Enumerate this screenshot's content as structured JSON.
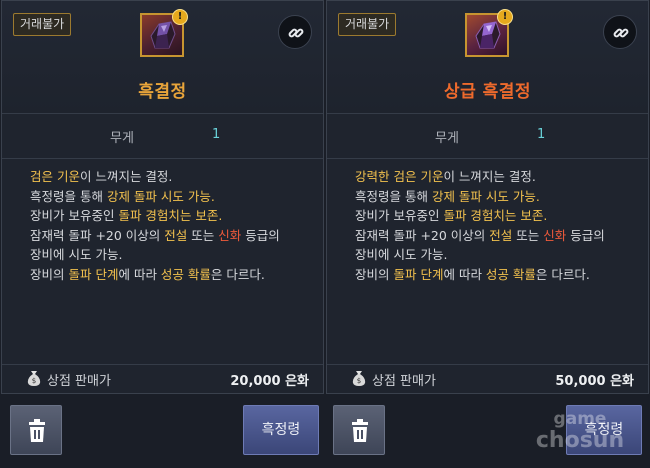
{
  "left_panel": {
    "trade_badge": "거래불가",
    "item_name": "흑결정",
    "stat_label": "무게",
    "stat_value": "1",
    "description": [
      [
        {
          "t": "검은 기운",
          "c": "y"
        },
        {
          "t": "이 느껴지는 결정.",
          "c": ""
        }
      ],
      [
        {
          "t": "흑정령을 통해 ",
          "c": ""
        },
        {
          "t": "강제 돌파 시도 가능.",
          "c": "y"
        }
      ],
      [
        {
          "t": "장비가 보유중인 ",
          "c": ""
        },
        {
          "t": "돌파 경험치는 보존.",
          "c": "y"
        }
      ],
      [
        {
          "t": "잠재력 돌파 +20 이상의 ",
          "c": ""
        },
        {
          "t": "전설",
          "c": "y"
        },
        {
          "t": " 또는 ",
          "c": ""
        },
        {
          "t": "신화",
          "c": "r"
        },
        {
          "t": " 등급의",
          "c": ""
        }
      ],
      [
        {
          "t": "장비에 시도 가능.",
          "c": ""
        }
      ],
      [
        {
          "t": "장비의 ",
          "c": ""
        },
        {
          "t": "돌파 단계",
          "c": "y"
        },
        {
          "t": "에 따라 ",
          "c": ""
        },
        {
          "t": "성공 확률",
          "c": "y"
        },
        {
          "t": "은 다르다.",
          "c": ""
        }
      ]
    ],
    "sale_label": "상점 판매가",
    "sale_value": "20,000 은화",
    "action_label": "흑정령"
  },
  "right_panel": {
    "trade_badge": "거래불가",
    "item_name": "상급 흑결정",
    "stat_label": "무게",
    "stat_value": "1",
    "description": [
      [
        {
          "t": "강력한 검은 기운",
          "c": "y"
        },
        {
          "t": "이 느껴지는 결정.",
          "c": ""
        }
      ],
      [
        {
          "t": "흑정령을 통해 ",
          "c": ""
        },
        {
          "t": "강제 돌파 시도 가능.",
          "c": "y"
        }
      ],
      [
        {
          "t": "장비가 보유중인 ",
          "c": ""
        },
        {
          "t": "돌파 경험치는 보존.",
          "c": "y"
        }
      ],
      [
        {
          "t": "잠재력 돌파 +20 이상의 ",
          "c": ""
        },
        {
          "t": "전설",
          "c": "y"
        },
        {
          "t": " 또는 ",
          "c": ""
        },
        {
          "t": "신화",
          "c": "r"
        },
        {
          "t": " 등급의",
          "c": ""
        }
      ],
      [
        {
          "t": "장비에 시도 가능.",
          "c": ""
        }
      ],
      [
        {
          "t": "장비의 ",
          "c": ""
        },
        {
          "t": "돌파 단계",
          "c": "y"
        },
        {
          "t": "에 따라 ",
          "c": ""
        },
        {
          "t": "성공 확률",
          "c": "y"
        },
        {
          "t": "은 다르다.",
          "c": ""
        }
      ]
    ],
    "sale_label": "상점 판매가",
    "sale_value": "50,000 은화",
    "action_label": "흑정령"
  },
  "icons": {
    "item": "dark-crystal-icon",
    "alert": "exclamation-badge-icon",
    "link": "link-icon",
    "money": "money-bag-icon",
    "trash": "trash-icon"
  },
  "colors": {
    "item_name_normal": "#e8a43a",
    "item_name_superior": "#ee6a2c",
    "highlight": "#f2c14e",
    "myth": "#ef5a3b",
    "stat_value": "#69d1d8"
  },
  "watermark": {
    "line1": "game",
    "line2": "chosun"
  }
}
